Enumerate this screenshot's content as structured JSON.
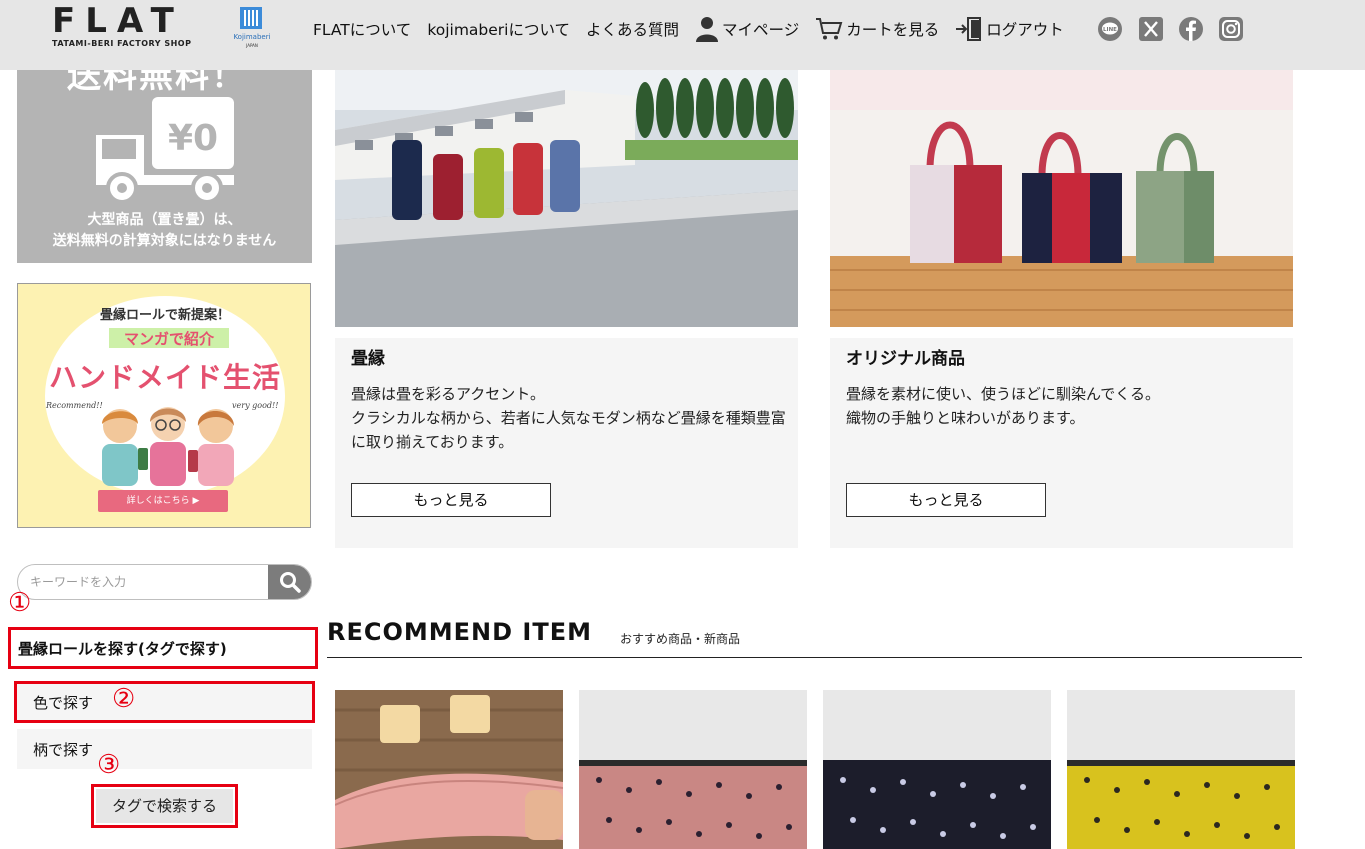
{
  "header": {
    "logo_main": "FLAT",
    "logo_sub": "TATAMI-BERI FACTORY SHOP",
    "partner_logo": "Kojimaberi",
    "partner_country": "JAPAN",
    "nav": [
      {
        "label": "FLATについて",
        "icon": ""
      },
      {
        "label": "kojimaberiについて",
        "icon": ""
      },
      {
        "label": "よくある質問",
        "icon": ""
      },
      {
        "label": "マイページ",
        "icon": "user-icon"
      },
      {
        "label": "カートを見る",
        "icon": "cart-icon"
      },
      {
        "label": "ログアウト",
        "icon": "logout-icon"
      }
    ],
    "social": [
      "line-icon",
      "x-icon",
      "facebook-icon",
      "instagram-icon"
    ],
    "social_line_text": "LINE"
  },
  "sidebar": {
    "free_shipping_title": "送料無料！",
    "free_shipping_price": "¥0",
    "free_shipping_note_1": "大型商品（置き畳）は、",
    "free_shipping_note_2": "送料無料の計算対象にはなりません",
    "manga_line1": "畳縁ロールで新提案！",
    "manga_line2": "マンガで紹介",
    "manga_line3": "ハンドメイド生活",
    "manga_recommend": "Recommend!!",
    "manga_verygood": "very good!!",
    "manga_button": "詳しくはこちら ▶",
    "search_placeholder": "キーワードを入力",
    "tag_title": "畳縁ロールを探す(タグで探す)",
    "tag_color": "色で探す",
    "tag_pattern": "柄で探す",
    "tag_search_button": "タグで検索する"
  },
  "annotations": {
    "one": "①",
    "two": "②",
    "three": "③"
  },
  "cards": [
    {
      "title": "畳縁",
      "desc_1": "畳縁は畳を彩るアクセント。",
      "desc_2": "クラシカルな柄から、若者に人気なモダン柄など畳縁を種類豊富に取り揃えております。",
      "button": "もっと見る"
    },
    {
      "title": "オリジナル商品",
      "desc_1": "畳縁を素材に使い、使うほどに馴染んでくる。",
      "desc_2": "織物の手触りと味わいがあります。",
      "button": "もっと見る"
    }
  ],
  "recommend": {
    "heading": "RECOMMEND ITEM",
    "sub": "おすすめ商品・新商品",
    "products": [
      {
        "color": "#e9a7a1"
      },
      {
        "color": "#c98784"
      },
      {
        "color": "#1c1d2b"
      },
      {
        "color": "#d8c21e"
      }
    ]
  },
  "colors": {
    "annotation_red": "#e60012",
    "header_bg": "#e6e6e6",
    "card_bg": "#f5f5f5"
  }
}
